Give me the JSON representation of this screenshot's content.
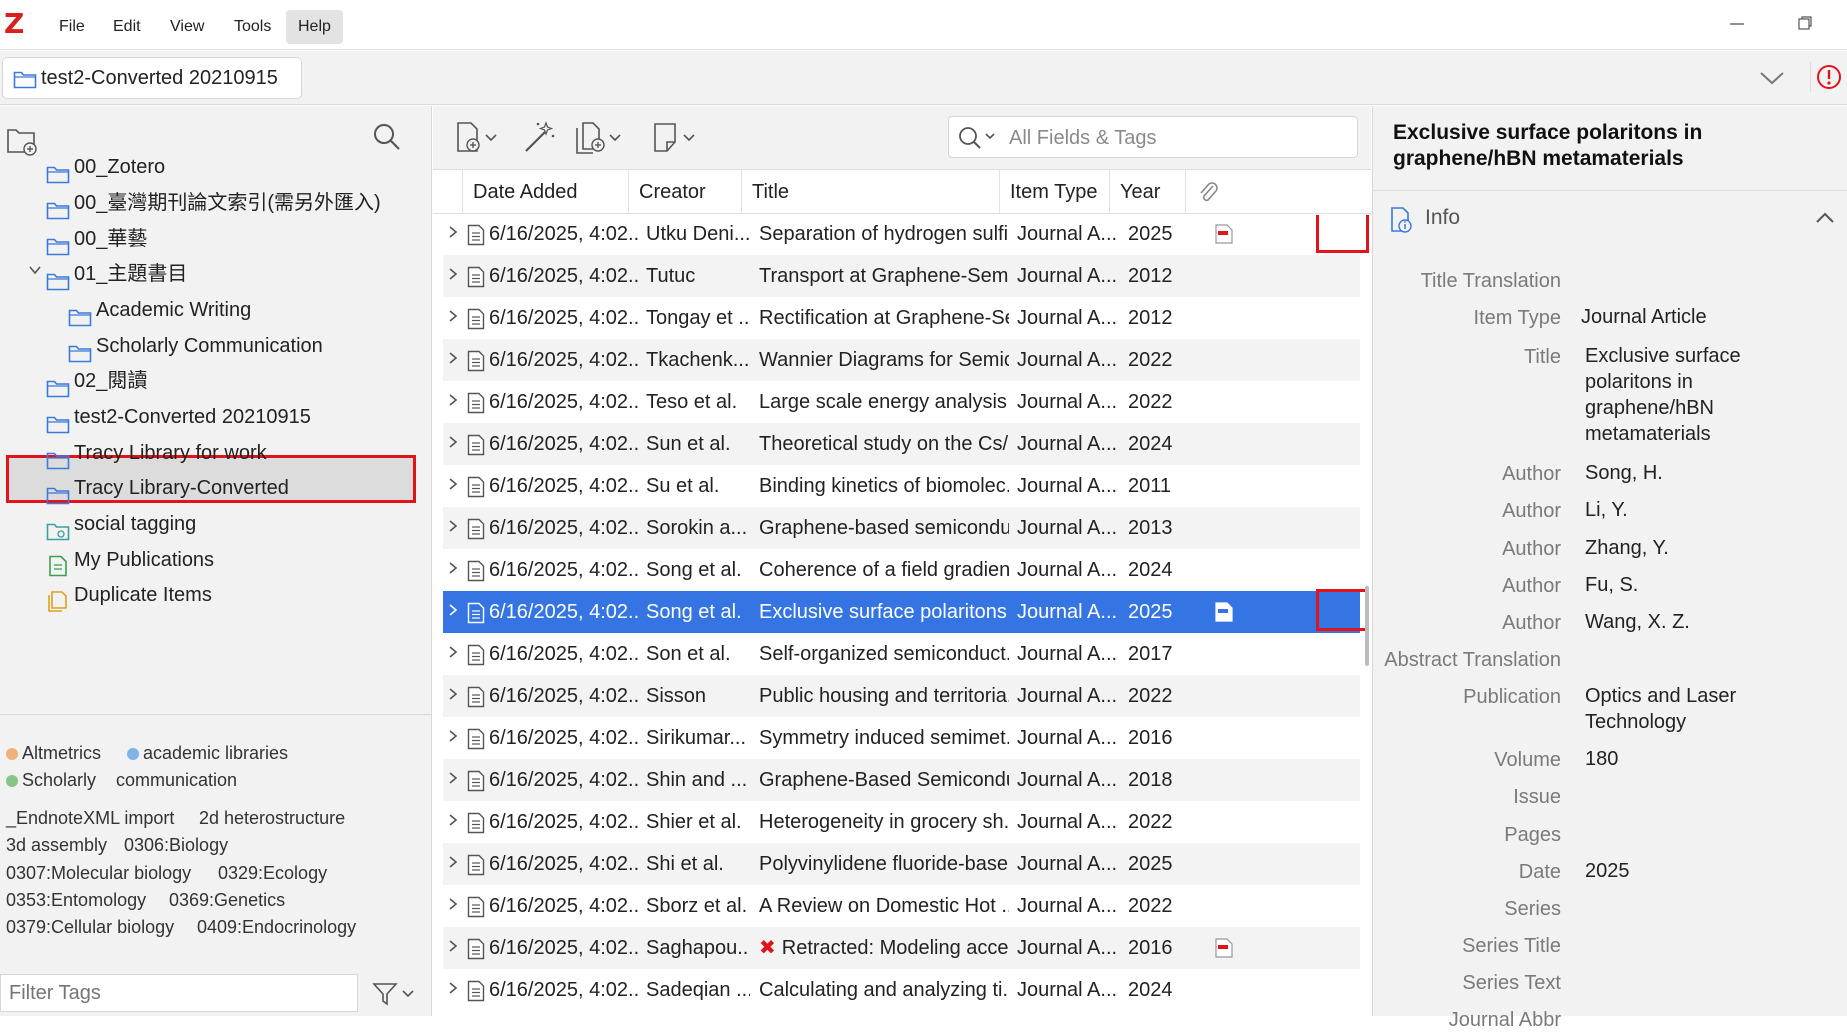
{
  "menubar": {
    "items": [
      "File",
      "Edit",
      "View",
      "Tools",
      "Help"
    ],
    "logo": "Z"
  },
  "tab": {
    "label": "test2-Converted 20210915"
  },
  "collections": [
    {
      "label": "00_Zotero"
    },
    {
      "label": "00_臺灣期刊論文索引(需另外匯入)"
    },
    {
      "label": "00_華藝"
    },
    {
      "label": "01_主題書目"
    },
    {
      "label": "Academic Writing"
    },
    {
      "label": "Scholarly Communication"
    },
    {
      "label": "02_閱讀"
    },
    {
      "label": "test2-Converted 20210915"
    },
    {
      "label": "Tracy Library for work"
    },
    {
      "label": "Tracy Library-Converted"
    },
    {
      "label": "social tagging"
    },
    {
      "label": "My Publications"
    },
    {
      "label": "Duplicate Items"
    }
  ],
  "tags": {
    "colored": [
      {
        "label": "Altmetrics",
        "color": "#f0b27a"
      },
      {
        "label": "academic libraries",
        "color": "#7fb3e8"
      },
      {
        "label": "Scholarly",
        "color": "#88c488"
      },
      {
        "label": "communication",
        "color": ""
      }
    ],
    "plain": [
      "_EndnoteXML import",
      "2d heterostructure",
      "3d assembly",
      "0306:Biology",
      "0307:Molecular biology",
      "0329:Ecology",
      "0353:Entomology",
      "0369:Genetics",
      "0379:Cellular biology",
      "0409:Endocrinology"
    ],
    "filter_placeholder": "Filter Tags"
  },
  "search": {
    "placeholder": "All Fields & Tags"
  },
  "columns": [
    "Date Added",
    "Creator",
    "Title",
    "Item Type",
    "Year"
  ],
  "rows": [
    {
      "date": "6/16/2025, 4:02...",
      "creator": "Utku Deni...",
      "title": "Separation of hydrogen sulfi...",
      "type": "Journal A...",
      "year": "2025",
      "attach": "pdf"
    },
    {
      "date": "6/16/2025, 4:02...",
      "creator": "Tutuc",
      "title": "Transport at Graphene-Semi...",
      "type": "Journal A...",
      "year": "2012",
      "attach": ""
    },
    {
      "date": "6/16/2025, 4:02...",
      "creator": "Tongay et ...",
      "title": "Rectification at Graphene-Se...",
      "type": "Journal A...",
      "year": "2012",
      "attach": ""
    },
    {
      "date": "6/16/2025, 4:02...",
      "creator": "Tkachenk...",
      "title": "Wannier Diagrams for Semic...",
      "type": "Journal A...",
      "year": "2022",
      "attach": ""
    },
    {
      "date": "6/16/2025, 4:02...",
      "creator": "Teso et al.",
      "title": "Large scale energy analysis a...",
      "type": "Journal A...",
      "year": "2022",
      "attach": ""
    },
    {
      "date": "6/16/2025, 4:02...",
      "creator": "Sun et al.",
      "title": "Theoretical study on the Cs/...",
      "type": "Journal A...",
      "year": "2024",
      "attach": ""
    },
    {
      "date": "6/16/2025, 4:02...",
      "creator": "Su et al.",
      "title": "Binding kinetics of biomolec...",
      "type": "Journal A...",
      "year": "2011",
      "attach": ""
    },
    {
      "date": "6/16/2025, 4:02...",
      "creator": "Sorokin a...",
      "title": "Graphene-based semicondu...",
      "type": "Journal A...",
      "year": "2013",
      "attach": ""
    },
    {
      "date": "6/16/2025, 4:02...",
      "creator": "Song et al.",
      "title": "Coherence of a field gradien...",
      "type": "Journal A...",
      "year": "2024",
      "attach": ""
    },
    {
      "date": "6/16/2025, 4:02...",
      "creator": "Song et al.",
      "title": "Exclusive surface polaritons i...",
      "type": "Journal A...",
      "year": "2025",
      "attach": "pdf"
    },
    {
      "date": "6/16/2025, 4:02...",
      "creator": "Son et al.",
      "title": "Self-organized semiconduct...",
      "type": "Journal A...",
      "year": "2017",
      "attach": ""
    },
    {
      "date": "6/16/2025, 4:02...",
      "creator": "Sisson",
      "title": "Public housing and territoria...",
      "type": "Journal A...",
      "year": "2022",
      "attach": ""
    },
    {
      "date": "6/16/2025, 4:02...",
      "creator": "Sirikumar...",
      "title": "Symmetry induced semimet...",
      "type": "Journal A...",
      "year": "2016",
      "attach": ""
    },
    {
      "date": "6/16/2025, 4:02...",
      "creator": "Shin and ...",
      "title": "Graphene-Based Semicondu...",
      "type": "Journal A...",
      "year": "2018",
      "attach": ""
    },
    {
      "date": "6/16/2025, 4:02...",
      "creator": "Shier et al.",
      "title": "Heterogeneity in grocery sh...",
      "type": "Journal A...",
      "year": "2022",
      "attach": ""
    },
    {
      "date": "6/16/2025, 4:02...",
      "creator": "Shi et al.",
      "title": "Polyvinylidene fluoride-base...",
      "type": "Journal A...",
      "year": "2025",
      "attach": ""
    },
    {
      "date": "6/16/2025, 4:02...",
      "creator": "Sborz et al.",
      "title": "A Review on Domestic Hot ...",
      "type": "Journal A...",
      "year": "2022",
      "attach": ""
    },
    {
      "date": "6/16/2025, 4:02...",
      "creator": "Saghapou...",
      "title": "Retracted: Modeling acce...",
      "type": "Journal A...",
      "year": "2016",
      "attach": "pdf",
      "retracted": true
    },
    {
      "date": "6/16/2025, 4:02...",
      "creator": "Sadeqian ...",
      "title": "Calculating and analyzing ti...",
      "type": "Journal A...",
      "year": "2024",
      "attach": ""
    }
  ],
  "item": {
    "title": "Exclusive surface polaritons in graphene/hBN metamaterials",
    "section": "Info",
    "fields": [
      {
        "label": "Title Translation",
        "value": ""
      },
      {
        "label": "Item Type",
        "value": "Journal Article"
      },
      {
        "label": "Title",
        "value": "Exclusive surface polaritons in graphene/hBN metamaterials"
      },
      {
        "label": "Author",
        "value": "Song, H."
      },
      {
        "label": "Author",
        "value": "Li, Y."
      },
      {
        "label": "Author",
        "value": "Zhang, Y."
      },
      {
        "label": "Author",
        "value": "Fu, S."
      },
      {
        "label": "Author",
        "value": "Wang, X. Z."
      },
      {
        "label": "Abstract Translation",
        "value": ""
      },
      {
        "label": "Publication",
        "value": "Optics and Laser Technology"
      },
      {
        "label": "Volume",
        "value": "180"
      },
      {
        "label": "Issue",
        "value": ""
      },
      {
        "label": "Pages",
        "value": ""
      },
      {
        "label": "Date",
        "value": "2025"
      },
      {
        "label": "Series",
        "value": ""
      },
      {
        "label": "Series Title",
        "value": ""
      },
      {
        "label": "Series Text",
        "value": ""
      },
      {
        "label": "Journal Abbr",
        "value": ""
      }
    ]
  },
  "colors": {
    "selection": "#3574e3",
    "highlight_box": "#e0141a",
    "brand": "#d8201f"
  }
}
